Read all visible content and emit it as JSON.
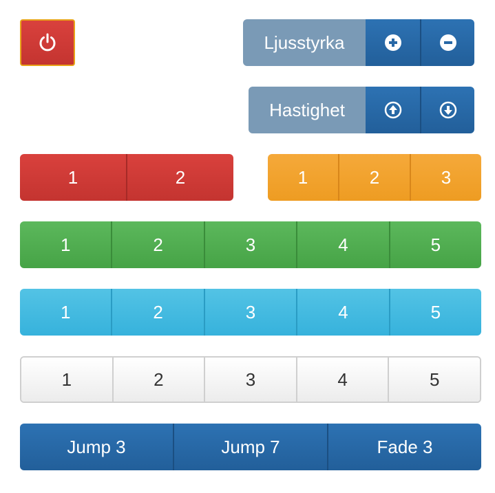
{
  "brightness": {
    "label": "Ljusstyrka",
    "increase_icon": "plus-circle-icon",
    "decrease_icon": "minus-circle-icon"
  },
  "speed": {
    "label": "Hastighet",
    "up_icon": "arrow-up-circle-icon",
    "down_icon": "arrow-down-circle-icon"
  },
  "power": {
    "icon": "power-icon"
  },
  "red_group": [
    "1",
    "2"
  ],
  "orange_group": [
    "1",
    "2",
    "3"
  ],
  "green_group": [
    "1",
    "2",
    "3",
    "4",
    "5"
  ],
  "cyan_group": [
    "1",
    "2",
    "3",
    "4",
    "5"
  ],
  "white_group": [
    "1",
    "2",
    "3",
    "4",
    "5"
  ],
  "effects": [
    "Jump 3",
    "Jump 7",
    "Fade 3"
  ],
  "colors": {
    "red": "#d03b37",
    "orange": "#f0a22c",
    "green": "#52ad52",
    "cyan": "#45bbe1",
    "white": "#f5f5f5",
    "blue": "#2868a6",
    "label_gray_blue": "#7a9ab6"
  }
}
